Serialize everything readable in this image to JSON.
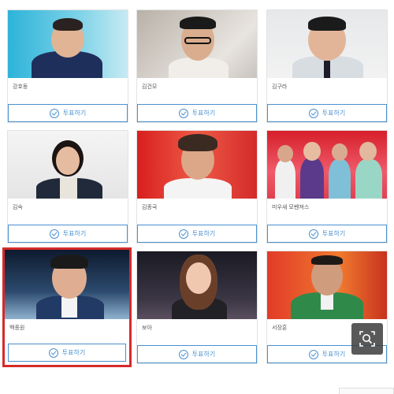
{
  "vote_button_label": "투표하기",
  "candidates": [
    {
      "name": "강호동"
    },
    {
      "name": "김건모"
    },
    {
      "name": "김구라"
    },
    {
      "name": "김숙"
    },
    {
      "name": "김종국"
    },
    {
      "name": "미우새 모벤져스"
    },
    {
      "name": "백종원",
      "selected": true
    },
    {
      "name": "보아"
    },
    {
      "name": "서장훈"
    }
  ],
  "colors": {
    "accent": "#4a90d0",
    "selected_border": "#d62a2a"
  },
  "icons": {
    "vote": "check-circle-icon",
    "zoom": "zoom-search-icon"
  }
}
